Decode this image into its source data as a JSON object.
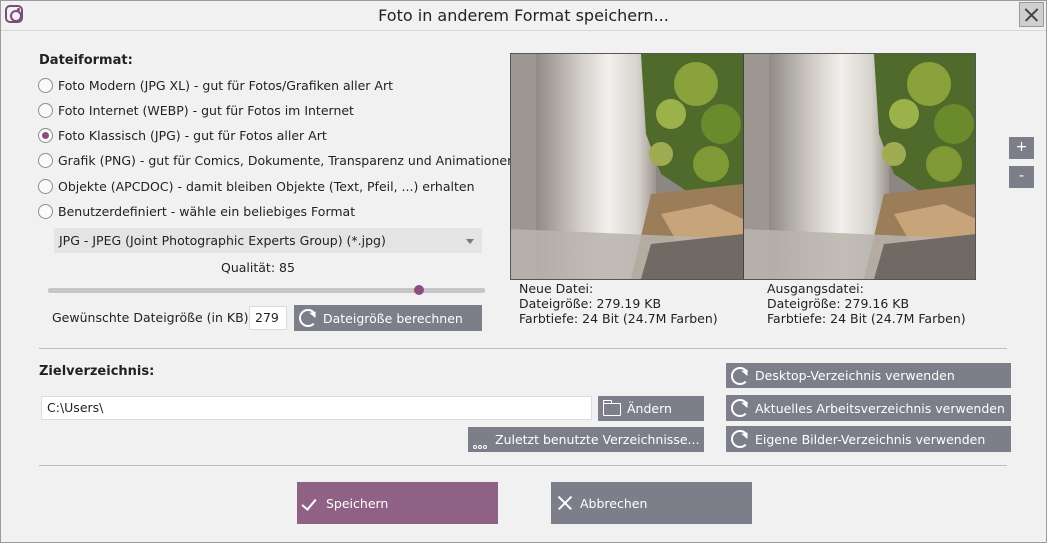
{
  "window": {
    "title": "Foto in anderem Format speichern...",
    "icon": "instagram-camera-icon"
  },
  "format": {
    "heading": "Dateiformat:",
    "options": [
      {
        "label": "Foto Modern (JPG XL) - gut für Fotos/Grafiken aller Art",
        "checked": false
      },
      {
        "label": "Foto Internet (WEBP) - gut für Fotos im Internet",
        "checked": false
      },
      {
        "label": "Foto Klassisch (JPG) - gut für Fotos aller Art",
        "checked": true
      },
      {
        "label": "Grafik (PNG) - gut für Comics, Dokumente, Transparenz und Animationen",
        "checked": false
      },
      {
        "label": "Objekte (APCDOC) - damit bleiben Objekte (Text, Pfeil, ...) erhalten",
        "checked": false
      },
      {
        "label": "Benutzerdefiniert - wähle ein beliebiges Format",
        "checked": false
      }
    ],
    "selected_type": "JPG - JPEG (Joint Photographic Experts Group) (*.jpg)",
    "quality_label": "Qualität:",
    "quality_value": "85",
    "quality_fraction": 0.85,
    "filesize_label": "Gewünschte Dateigröße (in KB):",
    "filesize_value": "279",
    "calc_button": "Dateigröße berechnen"
  },
  "preview": {
    "new_file": {
      "heading": "Neue Datei:",
      "size": "Dateigröße: 279.19 KB",
      "depth": "Farbtiefe: 24 Bit (24.7M Farben)"
    },
    "source_file": {
      "heading": "Ausgangsdatei:",
      "size": "Dateigröße: 279.16 KB",
      "depth": "Farbtiefe: 24 Bit (24.7M Farben)"
    },
    "zoom_in": "+",
    "zoom_out": "-"
  },
  "target": {
    "heading": "Zielverzeichnis:",
    "path": "C:\\Users\\",
    "change_button": "Ändern",
    "recent_button": "Zuletzt benutzte Verzeichnisse...",
    "desktop_button": "Desktop-Verzeichnis verwenden",
    "workdir_button": "Aktuelles Arbeitsverzeichnis verwenden",
    "pictures_button": "Eigene Bilder-Verzeichnis verwenden"
  },
  "actions": {
    "save": "Speichern",
    "cancel": "Abbrechen"
  },
  "colors": {
    "accent": "#8b4d7f",
    "button": "#7c7f8a",
    "save_button": "#8f6285"
  }
}
